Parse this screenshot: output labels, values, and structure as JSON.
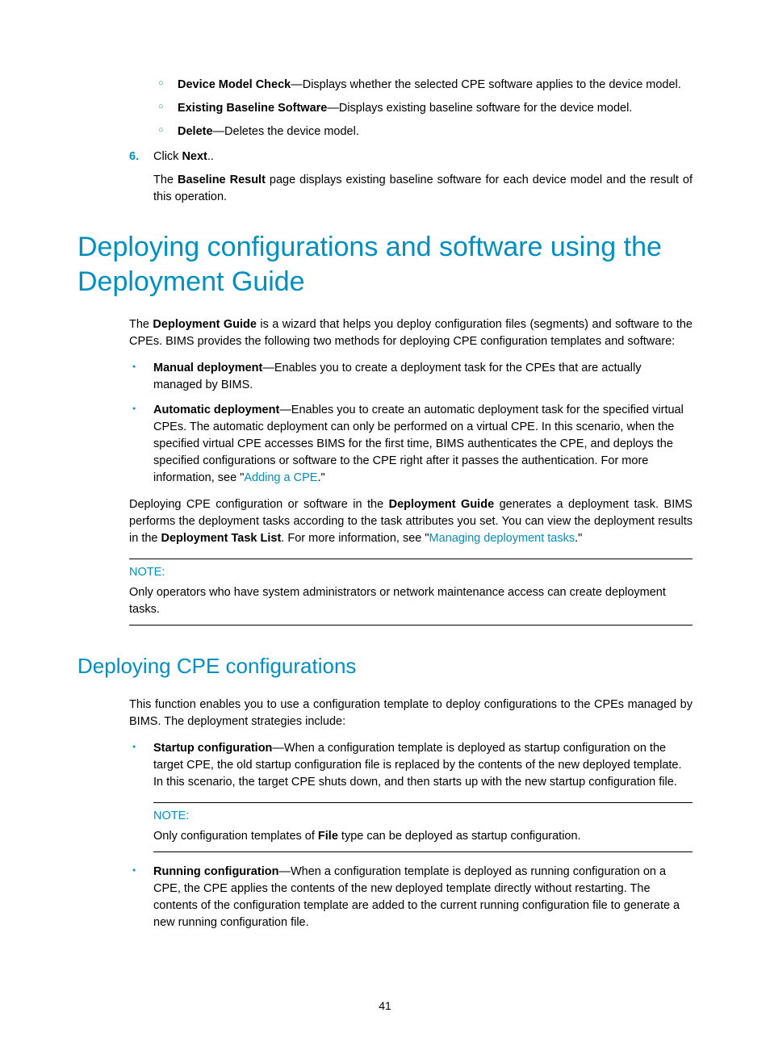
{
  "sub_items": [
    {
      "term": "Device Model Check",
      "desc": "—Displays whether the selected CPE software applies to the device model."
    },
    {
      "term": "Existing Baseline Software",
      "desc": "—Displays existing baseline software for the device model."
    },
    {
      "term": "Delete",
      "desc": "—Deletes the device model."
    }
  ],
  "step6": {
    "num": "6.",
    "text_prefix": "Click ",
    "text_bold": "Next",
    "text_suffix": "..",
    "result_prefix": "The ",
    "result_bold": "Baseline Result",
    "result_suffix": " page displays existing baseline software for each device model and the result of this operation."
  },
  "h1": "Deploying configurations and software using the Deployment Guide",
  "intro": {
    "p1_pre": "The ",
    "p1_b": "Deployment Guide",
    "p1_post": " is a wizard that helps you deploy configuration files (segments) and software to the CPEs. BIMS provides the following two methods for deploying CPE configuration templates and software:"
  },
  "methods": [
    {
      "term": "Manual deployment",
      "desc": "—Enables you to create a deployment task for the CPEs that are actually managed by BIMS."
    },
    {
      "term": "Automatic deployment",
      "desc_pre": "—Enables you to create an automatic deployment task for the specified virtual CPEs. The automatic deployment can only be performed on a virtual CPE. In this scenario, when the specified virtual CPE accesses BIMS for the first time, BIMS authenticates the CPE, and deploys the specified configurations or software to the CPE right after it passes the authentication. For more information, see \"",
      "link": "Adding a CPE",
      "desc_post": ".\""
    }
  ],
  "para_deploy": {
    "pre": "Deploying CPE configuration or software in the ",
    "b1": "Deployment Guide",
    "mid1": " generates a deployment task. BIMS performs the deployment tasks according to the task attributes you set. You can view the deployment results in the ",
    "b2": "Deployment Task List",
    "mid2": ". For more information, see \"",
    "link": "Managing deployment tasks",
    "post": ".\""
  },
  "note1": {
    "title": "NOTE:",
    "body": "Only operators who have system administrators or network maintenance access can create deployment tasks."
  },
  "h2": "Deploying CPE configurations",
  "h2_intro": "This function enables you to use a configuration template to deploy configurations to the CPEs managed by BIMS. The deployment strategies include:",
  "strategies": [
    {
      "term": "Startup configuration",
      "desc": "—When a configuration template is deployed as startup configuration on the target CPE, the old startup configuration file is replaced by the contents of the new deployed template. In this scenario, the target CPE shuts down, and then starts up with the new startup configuration file."
    },
    {
      "term": "Running configuration",
      "desc": "—When a configuration template is deployed as running configuration on a CPE, the CPE applies the contents of the new deployed template directly without restarting. The contents of the configuration template are added to the current running configuration file to generate a new running configuration file."
    }
  ],
  "note2": {
    "title": "NOTE:",
    "pre": "Only configuration templates of ",
    "b": "File",
    "post": " type can be deployed as startup configuration."
  },
  "page_number": "41"
}
